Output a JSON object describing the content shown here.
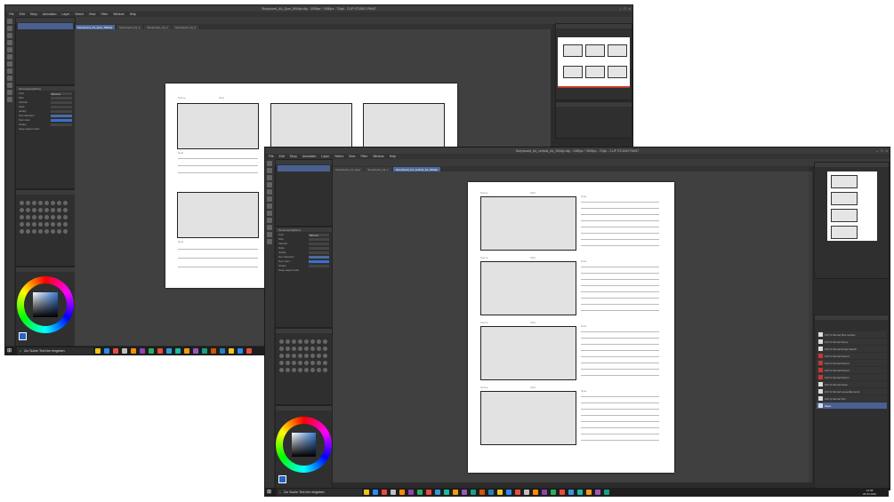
{
  "window_back": {
    "title": "Storyboard_A4_Quer_800dpi.clip - 3508px * 2480px - 72dpi - CLIP STUDIO PAINT",
    "menu": [
      "File",
      "Edit",
      "Story",
      "Animation",
      "Layer",
      "Select",
      "View",
      "Filter",
      "Window",
      "Help"
    ],
    "tabs": [
      "Storyboard_A4_Quer_800dpi",
      "Storyboard_A4_1",
      "Storyboard_A4_2",
      "Storyboard_A4_3"
    ],
    "tool_property_title": "Tool property[Text]",
    "tool_rows": [
      "Font",
      "Size",
      "Vertical",
      "Style",
      "Justify",
      "Text direction",
      "Text color",
      "Stroke"
    ],
    "font_value": "Tahoma",
    "keep_aspect": "Keep aspect ratio",
    "page": {
      "panel_labels": [
        "Scene",
        "Shot"
      ],
      "note_label": "Note"
    }
  },
  "window_front": {
    "title": "Storyboard_A4_vertical_A4_300dpi.clip - 2480px * 3508px - 72dpi - CLIP STUDIO PAINT",
    "menu": [
      "File",
      "Edit",
      "Story",
      "Animation",
      "Layer",
      "Select",
      "View",
      "Filter",
      "Window",
      "Help"
    ],
    "tabs": [
      "Storyboard_A4_Quer",
      "Storyboard_A4_1",
      "Storyboard_A4_vertical_A4_300dpi"
    ],
    "tool_property_title": "Tool property[Text]",
    "tool_rows": [
      "Font",
      "Size",
      "Vertical",
      "Style",
      "Justify",
      "Text direction",
      "Text color",
      "Stroke"
    ],
    "font_value": "Tahoma",
    "keep_aspect": "Keep aspect ratio",
    "page": {
      "panel_labels": [
        "Scene",
        "Shot"
      ],
      "note_label": "Note"
    },
    "layers": [
      {
        "name": "100 % Normal Shot number"
      },
      {
        "name": "100 % Normal Scene"
      },
      {
        "name": "100 % Normal Rough Sketch"
      },
      {
        "name": "100 % Normal Panel 4"
      },
      {
        "name": "100 % Normal Panel 3"
      },
      {
        "name": "100 % Normal Panel 2"
      },
      {
        "name": "100 % Normal Panel 1"
      },
      {
        "name": "100 % Normal Notes"
      },
      {
        "name": "100 % Normal Layout Elements"
      },
      {
        "name": "100 % Normal Text"
      },
      {
        "name": "Paper"
      }
    ]
  },
  "taskbar_back": {
    "search_placeholder": "Zur Suche Text hier eingeben"
  },
  "taskbar_front": {
    "search_placeholder": "Zur Suche Text hier eingeben",
    "time": "12:08",
    "date": "26.04.2020"
  }
}
